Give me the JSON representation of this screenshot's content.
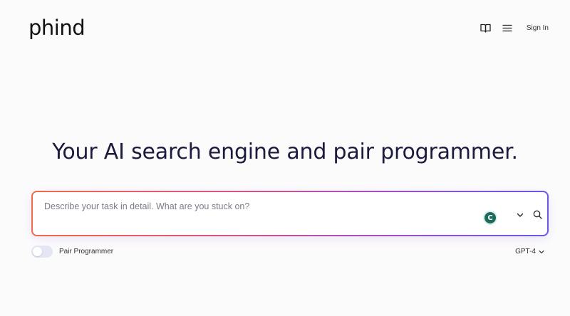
{
  "header": {
    "logo": "phind",
    "sign_in_label": "Sign In",
    "icons": [
      "book-icon",
      "menu-icon"
    ]
  },
  "hero": {
    "headline": "Your AI search engine and pair programmer."
  },
  "search": {
    "placeholder": "Describe your task in detail. What are you stuck on?",
    "value": "",
    "extension_badge": "C",
    "gradient_colors": [
      "#f26a4b",
      "#d9567c",
      "#9a4fc6",
      "#6a56e8"
    ]
  },
  "options": {
    "pair_programmer_label": "Pair Programmer",
    "pair_programmer_enabled": false,
    "model_label": "GPT-4"
  },
  "colors": {
    "background": "#fcfbfc",
    "headline": "#1c1a3d",
    "badge": "#1d6b5a"
  }
}
